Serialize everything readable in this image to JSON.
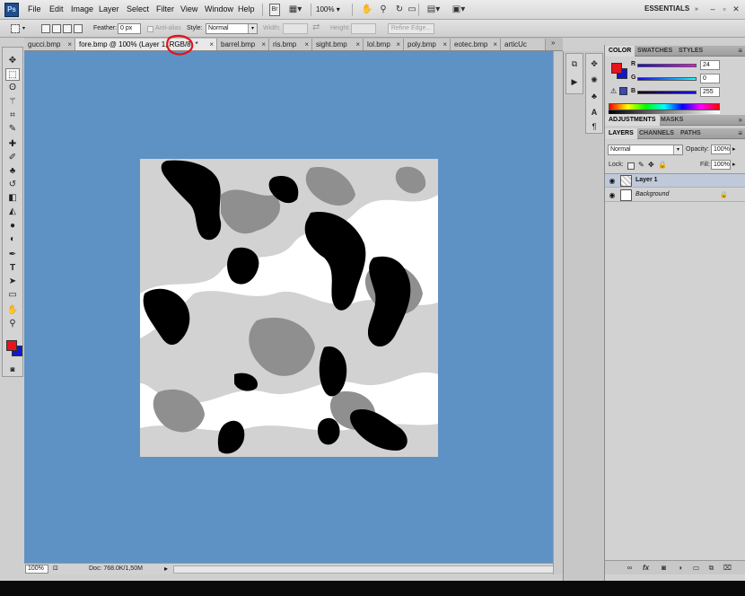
{
  "app": {
    "logo": "Ps",
    "workspace": "ESSENTIALS",
    "zoom": "100%"
  },
  "menu": [
    "File",
    "Edit",
    "Image",
    "Layer",
    "Select",
    "Filter",
    "View",
    "Window",
    "Help"
  ],
  "menubar_icons": [
    "bridge-icon",
    "mini-bridge-icon",
    "hand-icon",
    "zoom-icon",
    "rotate-icon",
    "arrange-icon",
    "screen-mode-icon"
  ],
  "window_controls": [
    "minimize-icon",
    "restore-icon",
    "close-icon"
  ],
  "options": {
    "feather_label": "Feather:",
    "feather_value": "0 px",
    "antialias_label": "Anti-alias",
    "style_label": "Style:",
    "style_value": "Normal",
    "width_label": "Width:",
    "height_label": "Height:",
    "refine_edge": "Refine Edge..."
  },
  "tabs": [
    {
      "label": "gucci.bmp",
      "active": false
    },
    {
      "label": "fore.bmp @ 100% (Layer 1, RGB/8) *",
      "active": true
    },
    {
      "label": "barrel.bmp",
      "active": false
    },
    {
      "label": "ris.bmp",
      "active": false
    },
    {
      "label": "sight.bmp",
      "active": false
    },
    {
      "label": "lol.bmp",
      "active": false
    },
    {
      "label": "poly.bmp",
      "active": false
    },
    {
      "label": "eotec.bmp",
      "active": false
    },
    {
      "label": "articUc",
      "active": false
    }
  ],
  "tab_more": "»",
  "tab_close": "×",
  "tools": [
    "move-tool-icon",
    "marquee-tool-icon",
    "lasso-tool-icon",
    "magic-wand-icon",
    "crop-tool-icon",
    "eyedropper-icon",
    "healing-brush-icon",
    "brush-tool-icon",
    "clone-stamp-icon",
    "history-brush-icon",
    "eraser-tool-icon",
    "paint-bucket-icon",
    "blur-tool-icon",
    "dodge-tool-icon",
    "pen-tool-icon",
    "type-tool-icon",
    "path-select-icon",
    "shape-tool-icon",
    "hand-tool-icon",
    "zoom-tool-icon"
  ],
  "colors": {
    "foreground": "#e8141c",
    "background": "#1018c8",
    "canvas_bg": "#5f92c4",
    "annotation": "#e0141c"
  },
  "status": {
    "zoom": "100%",
    "doc": "Doc: 768.0K/1,50M"
  },
  "color_panel": {
    "tabs": [
      "COLOR",
      "SWATCHES",
      "STYLES"
    ],
    "channels": [
      {
        "label": "R",
        "value": "24"
      },
      {
        "label": "G",
        "value": "0"
      },
      {
        "label": "B",
        "value": "255"
      }
    ]
  },
  "adjust_panel": {
    "tabs": [
      "ADJUSTMENTS",
      "MASKS"
    ]
  },
  "layers_panel": {
    "tabs": [
      "LAYERS",
      "CHANNELS",
      "PATHS"
    ],
    "blend_mode": "Normal",
    "opacity_label": "Opacity:",
    "opacity": "100%",
    "lock_label": "Lock:",
    "fill_label": "Fill:",
    "fill": "100%",
    "layers": [
      {
        "name": "Layer 1",
        "selected": true,
        "locked": false
      },
      {
        "name": "Background",
        "selected": false,
        "locked": true
      }
    ]
  },
  "layer_footer_icons": [
    "link-layers-icon",
    "layer-style-icon",
    "add-mask-icon",
    "adjustment-layer-icon",
    "new-group-icon",
    "new-layer-icon",
    "delete-layer-icon"
  ]
}
